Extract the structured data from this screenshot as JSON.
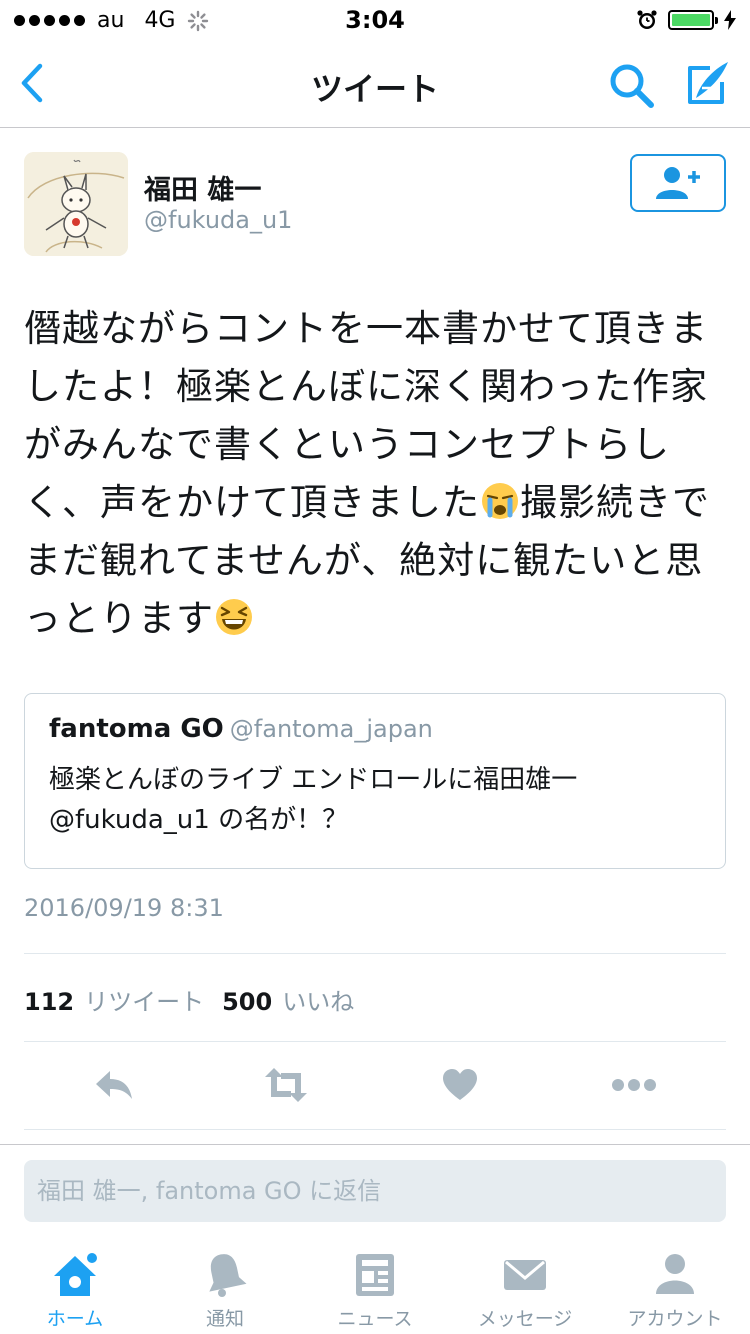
{
  "status_bar": {
    "carrier": "au",
    "network": "4G",
    "time": "3:04",
    "battery_level": 1.0
  },
  "nav": {
    "title": "ツイート",
    "back_icon": "chevron-left-icon",
    "search_icon": "search-icon",
    "compose_icon": "compose-icon"
  },
  "tweet": {
    "author_name": "福田 雄一",
    "author_handle": "@fukuda_u1",
    "text_parts": [
      "僭越ながらコントを一本書かせて頂きましたよ！極楽とんぼに深く関わった作家がみんなで書くというコンセプトらしく、声をかけて頂きました",
      "撮影続きでまだ観れてませんが、絶対に観たいと思っとります"
    ],
    "emoji_1": "crying-face-emoji",
    "emoji_2": "laughing-face-emoji",
    "timestamp": "2016/09/19 8:31",
    "retweet_count": "112",
    "retweet_label": "リツイート",
    "like_count": "500",
    "like_label": "いいね"
  },
  "quote": {
    "name": "fantoma GO",
    "handle": "@fantoma_japan",
    "text": "極楽とんぼのライブ エンドロールに福田雄一 @fukuda_u1 の名が！？"
  },
  "reply": {
    "placeholder": "福田 雄一, fantoma GO に返信"
  },
  "tabs": [
    {
      "label": "ホーム",
      "icon": "home-icon",
      "active": true,
      "badge": true
    },
    {
      "label": "通知",
      "icon": "bell-icon"
    },
    {
      "label": "ニュース",
      "icon": "news-icon"
    },
    {
      "label": "メッセージ",
      "icon": "envelope-icon"
    },
    {
      "label": "アカウント",
      "icon": "person-icon"
    }
  ],
  "colors": {
    "accent": "#1da1f2",
    "secondary_text": "#8899a6",
    "action_icon": "#aab8c2"
  }
}
